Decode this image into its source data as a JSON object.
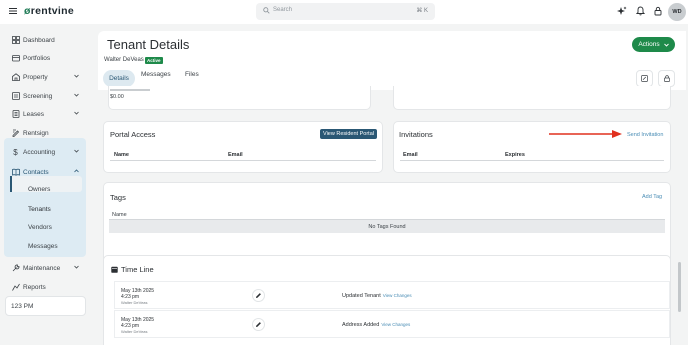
{
  "app": {
    "brand_mark": "ø",
    "brand_name": "rentvine"
  },
  "search": {
    "placeholder": "Search",
    "shortcut": "⌘ K"
  },
  "user": {
    "initials": "WD"
  },
  "sidebar": {
    "items": [
      {
        "label": "Dashboard",
        "icon": "grid-icon"
      },
      {
        "label": "Portfolios",
        "icon": "folder-icon"
      },
      {
        "label": "Property",
        "icon": "building-icon"
      },
      {
        "label": "Screening",
        "icon": "screening-icon"
      },
      {
        "label": "Leases",
        "icon": "lease-icon"
      },
      {
        "label": "Rentsign",
        "icon": "sign-icon"
      },
      {
        "label": "Accounting",
        "icon": "dollar-icon"
      },
      {
        "label": "Contacts",
        "icon": "book-icon"
      },
      {
        "label": "Maintenance",
        "icon": "wrench-icon"
      },
      {
        "label": "Reports",
        "icon": "report-icon"
      }
    ],
    "contacts_sub": [
      "Owners",
      "Tenants",
      "Vendors",
      "Messages"
    ],
    "time": "123 PM"
  },
  "header": {
    "title": "Tenant Details",
    "tenant_name": "Walter DeVeas",
    "status": "Active",
    "actions_label": "Actions",
    "tabs": [
      "Details",
      "Messages",
      "Files"
    ]
  },
  "summary": {
    "value": "$0.00"
  },
  "portal": {
    "title": "Portal Access",
    "button": "View Resident Portal",
    "columns": [
      "Name",
      "Email"
    ]
  },
  "invitations": {
    "title": "Invitations",
    "send_link": "Send Invitation",
    "columns": [
      "Email",
      "Expires"
    ]
  },
  "tags": {
    "title": "Tags",
    "add_link": "Add Tag",
    "column": "Name",
    "empty": "No Tags Found"
  },
  "timeline": {
    "title": "Time Line",
    "entries": [
      {
        "date": "May 13th 2025",
        "time": "4:23 pm",
        "by": "Walter DeVeas",
        "event": "Updated Tenant",
        "link": "View Changes"
      },
      {
        "date": "May 13th 2025",
        "time": "4:23 pm",
        "by": "Walter DeVeas",
        "event": "Address Added",
        "link": "View Changes"
      }
    ]
  },
  "colors": {
    "brand_green": "#1e8a4a",
    "nav_active": "#2a5774",
    "link": "#4a8db5",
    "arrow": "#e0301e"
  }
}
